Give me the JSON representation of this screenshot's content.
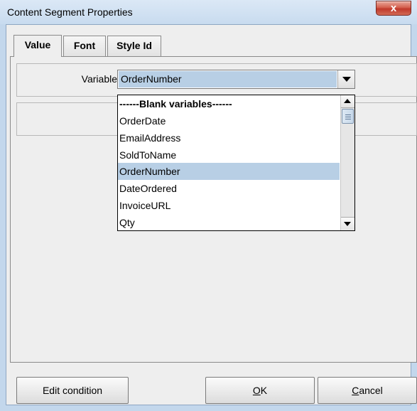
{
  "window": {
    "title": "Content Segment Properties",
    "close_glyph": "x"
  },
  "tabs": [
    {
      "label": "Value",
      "active": true
    },
    {
      "label": "Font",
      "active": false
    },
    {
      "label": "Style Id",
      "active": false
    }
  ],
  "variable": {
    "label": "Variable",
    "selected": "OrderNumber",
    "options": [
      "------Blank variables------",
      "OrderDate",
      "EmailAddress",
      "SoldToName",
      "OrderNumber",
      "DateOrdered",
      "InvoiceURL",
      "Qty"
    ],
    "highlighted_index": 4
  },
  "buttons": {
    "edit_condition": "Edit condition",
    "ok_mnemonic": "O",
    "ok_rest": "K",
    "cancel_mnemonic": "C",
    "cancel_rest": "ancel"
  },
  "colors": {
    "selection": "#b8cfe5",
    "frame": "#c3d7ec",
    "close_button": "#c0392b"
  }
}
